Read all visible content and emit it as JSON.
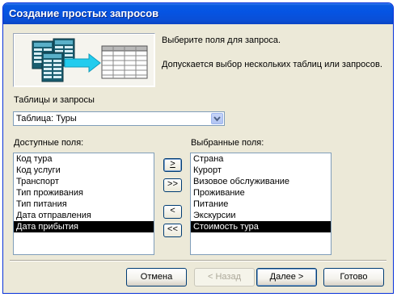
{
  "window": {
    "title": "Создание простых запросов"
  },
  "intro": {
    "line1": "Выберите поля для запроса.",
    "line2": "Допускается выбор нескольких таблиц или запросов."
  },
  "source": {
    "label": "Таблицы и запросы",
    "selected": "Таблица: Туры"
  },
  "available": {
    "label": "Доступные поля:",
    "items": [
      "Код тура",
      "Код услуги",
      "Транспорт",
      "Тип проживания",
      "Тип питания",
      "Дата отправления",
      "Дата прибытия"
    ],
    "selected_index": 6
  },
  "selected_fields": {
    "label": "Выбранные поля:",
    "items": [
      "Страна",
      "Курорт",
      "Визовое обслуживание",
      "Проживание",
      "Питание",
      "Экскурсии",
      "Стоимость тура"
    ],
    "selected_index": 6
  },
  "move_buttons": {
    "add_one": ">",
    "add_all": ">>",
    "remove_one": "<",
    "remove_all": "<<"
  },
  "buttons": {
    "cancel": "Отмена",
    "back": "< Назад",
    "next": "Далее >",
    "finish": "Готово"
  },
  "colors": {
    "titlebar": "#0554e3",
    "dialog_bg": "#ece9d8",
    "selection": "#000000"
  }
}
